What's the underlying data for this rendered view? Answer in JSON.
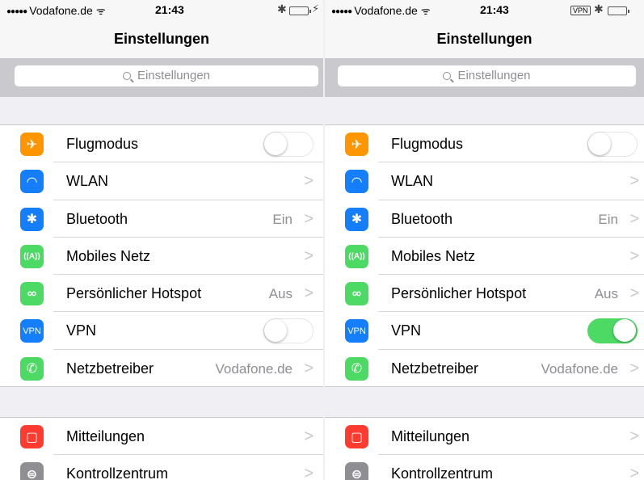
{
  "status_bar": {
    "signal": "●●●●●",
    "carrier": "Vodafone.de",
    "wifi": "ᯤ",
    "time": "21:43",
    "bluetooth": "✱",
    "charge": "⚡",
    "vpn_badge": "VPN"
  },
  "nav": {
    "title": "Einstellungen"
  },
  "search": {
    "placeholder": "Einstellungen"
  },
  "icons": {
    "plane": "✈",
    "wlan": "◠",
    "bluetooth": "✱",
    "cell": "((A))",
    "hotspot": "∞",
    "vpn": "VPN",
    "phone": "✆",
    "notifications": "▢",
    "control_center": "⊜"
  },
  "chevron": ">",
  "left": {
    "rows": [
      {
        "label": "Flugmodus"
      },
      {
        "label": "WLAN"
      },
      {
        "label": "Bluetooth",
        "detail": "Ein"
      },
      {
        "label": "Mobiles Netz"
      },
      {
        "label": "Persönlicher Hotspot",
        "detail": "Aus"
      },
      {
        "label": "VPN",
        "toggle_on": false
      },
      {
        "label": "Netzbetreiber",
        "detail": "Vodafone.de"
      }
    ],
    "rows2": [
      {
        "label": "Mitteilungen"
      },
      {
        "label": "Kontrollzentrum"
      }
    ]
  },
  "right": {
    "rows": [
      {
        "label": "Flugmodus"
      },
      {
        "label": "WLAN"
      },
      {
        "label": "Bluetooth",
        "detail": "Ein"
      },
      {
        "label": "Mobiles Netz"
      },
      {
        "label": "Persönlicher Hotspot",
        "detail": "Aus"
      },
      {
        "label": "VPN",
        "toggle_on": true
      },
      {
        "label": "Netzbetreiber",
        "detail": "Vodafone.de"
      }
    ],
    "rows2": [
      {
        "label": "Mitteilungen"
      },
      {
        "label": "Kontrollzentrum"
      }
    ]
  },
  "colors": {
    "orange": "#ff9500",
    "blue": "#147efb",
    "green": "#4cd964",
    "red": "#ff3b30",
    "gray": "#8e8e93"
  }
}
